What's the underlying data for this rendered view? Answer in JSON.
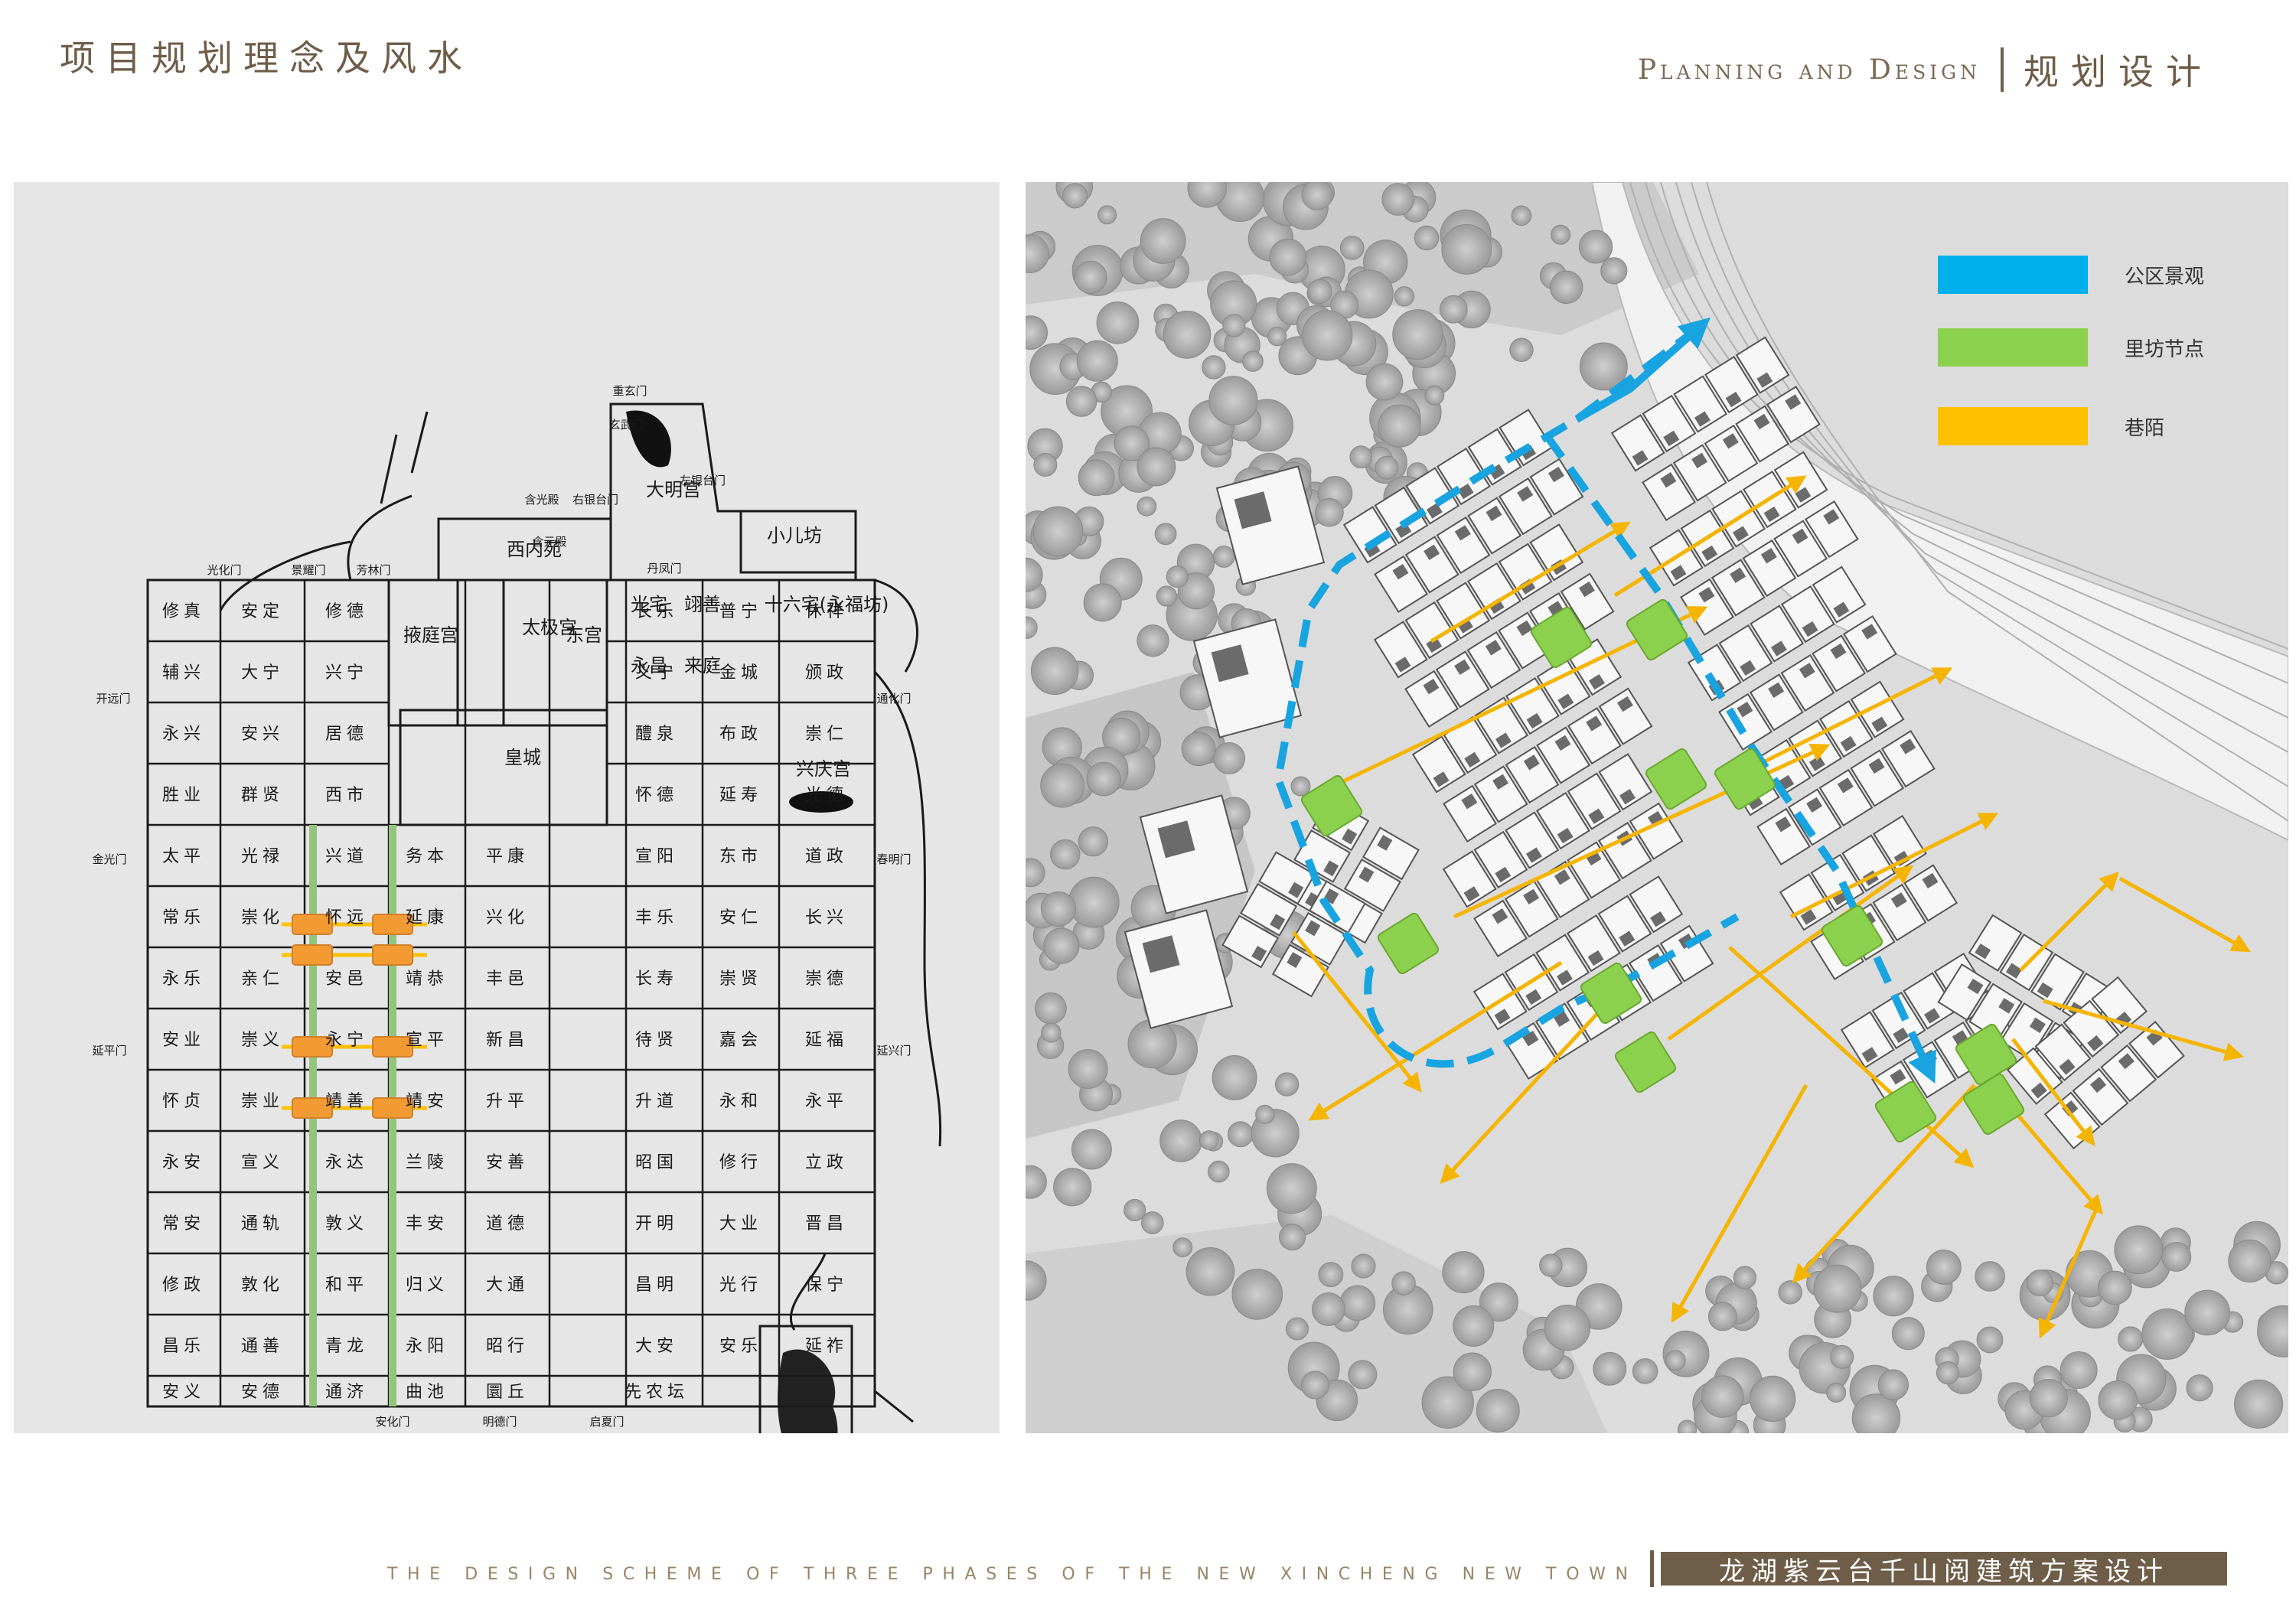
{
  "header": {
    "title": "项目规划理念及风水",
    "section_en": "Planning and Design",
    "section_cn": "规划设计"
  },
  "legend": {
    "items": [
      {
        "label": "公区景观",
        "color": "#00b0ec"
      },
      {
        "label": "里坊节点",
        "color": "#8cd14d"
      },
      {
        "label": "巷陌",
        "color": "#ffc000"
      }
    ]
  },
  "ancient_map": {
    "gates": [
      "重玄门",
      "玄武门",
      "右银台门",
      "左银台门",
      "含光殿",
      "含元殿",
      "丹凤门",
      "光化门",
      "景耀门",
      "芳林门",
      "开远门",
      "通化门",
      "金光门",
      "春明门",
      "延平门",
      "延兴门",
      "明德门",
      "启夏门",
      "安化门"
    ],
    "palaces": [
      "大明宫",
      "西内苑",
      "小儿坊",
      "太极宫",
      "掖庭宫",
      "东宫",
      "皇城",
      "兴庆宫",
      "十六宅(永福坊)",
      "光宅",
      "翊善",
      "永昌",
      "来庭"
    ],
    "wards": [
      "修真",
      "安定",
      "修德",
      "长乐",
      "普宁",
      "休祥",
      "辅兴",
      "大宁",
      "兴宁",
      "义宁",
      "金城",
      "颁政",
      "永兴",
      "安兴",
      "居德",
      "醴泉",
      "布政",
      "崇仁",
      "胜业",
      "群贤",
      "西市",
      "怀德",
      "延寿",
      "光德",
      "太平",
      "光禄",
      "兴道",
      "务本",
      "平康",
      "宣阳",
      "东市",
      "道政",
      "常乐",
      "崇化",
      "怀远",
      "延康",
      "兴化",
      "丰乐",
      "安仁",
      "长兴",
      "永乐",
      "亲仁",
      "安邑",
      "靖恭",
      "丰邑",
      "长寿",
      "崇贤",
      "崇德",
      "安业",
      "崇义",
      "永宁",
      "宣平",
      "新昌",
      "待贤",
      "嘉会",
      "延福",
      "怀贞",
      "崇业",
      "靖善",
      "靖安",
      "升平",
      "升道",
      "永和",
      "永平",
      "永安",
      "宣义",
      "永达",
      "兰陵",
      "安善",
      "昭国",
      "修行",
      "立政",
      "常安",
      "通轨",
      "敦义",
      "丰安",
      "道德",
      "开明",
      "大业",
      "晋昌",
      "修政",
      "敦化",
      "和平",
      "归义",
      "大通",
      "昌明",
      "光行",
      "保宁",
      "昌乐",
      "通善",
      "青龙",
      "永阳",
      "昭行",
      "大安",
      "安乐",
      "延祚",
      "安义",
      "安德",
      "通济",
      "曲池",
      "圜丘",
      "先农坛"
    ]
  },
  "footer": {
    "english": "THE DESIGN SCHEME OF THREE PHASES OF THE NEW XINCHENG NEW TOWN",
    "chinese": "龙湖紫云台千山阅建筑方案设计"
  }
}
